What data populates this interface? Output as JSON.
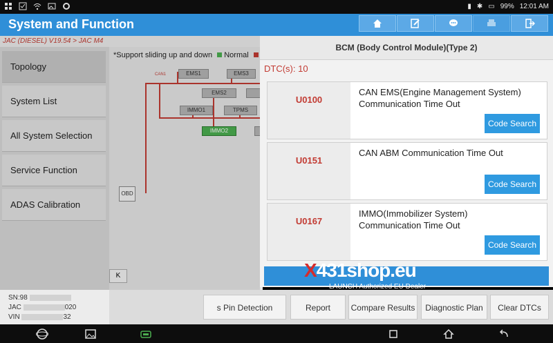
{
  "status": {
    "battery": "99%",
    "time": "12:01 AM"
  },
  "header": {
    "title": "System and Function"
  },
  "breadcrumb": "JAC (DIESEL) V19.54 > JAC M4",
  "sidebar": {
    "items": [
      {
        "label": "Topology"
      },
      {
        "label": "System List"
      },
      {
        "label": "All System Selection"
      },
      {
        "label": "Service Function"
      },
      {
        "label": "ADAS Calibration"
      }
    ]
  },
  "topology": {
    "note": "*Support sliding up and down",
    "legend_normal": "Normal",
    "bus_label": "CAN1",
    "nodes": [
      "EMS1",
      "EMS3",
      "EMS2",
      "IMMO1",
      "TPMS",
      "IMMO2",
      "OBD"
    ]
  },
  "panel": {
    "title": "BCM (Body Control Module)(Type 2)",
    "dtc_count": "DTC(s): 10",
    "dtcs": [
      {
        "code": "U0100",
        "desc_line1": "CAN EMS(Engine Management System)",
        "desc_line2": "Communication Time Out",
        "button": "Code Search"
      },
      {
        "code": "U0151",
        "desc_line1": "CAN ABM Communication Time Out",
        "desc_line2": "",
        "button": "Code Search"
      },
      {
        "code": "U0167",
        "desc_line1": "IMMO(Immobilizer System)",
        "desc_line2": "Communication Time Out",
        "button": "Code Search"
      }
    ]
  },
  "watermark": {
    "logo_x": "X",
    "logo_rest": "431shop.eu",
    "sub": "LAUNCH Authorized EU Dealer"
  },
  "info": {
    "sn": "SN:98",
    "jac": "JAC",
    "jac_tail": "020",
    "vin": "VIN",
    "vin_tail": "32"
  },
  "toolbar": {
    "pin_detection": "s Pin Detection",
    "report": "Report",
    "compare": "Compare Results",
    "plan": "Diagnostic Plan",
    "clear": "Clear DTCs",
    "k_button": "K"
  },
  "colors": {
    "header_blue": "#2f8fd8",
    "dtc_red": "#c23b33",
    "button_blue": "#2f9ae0",
    "normal_green": "#4caf50"
  }
}
